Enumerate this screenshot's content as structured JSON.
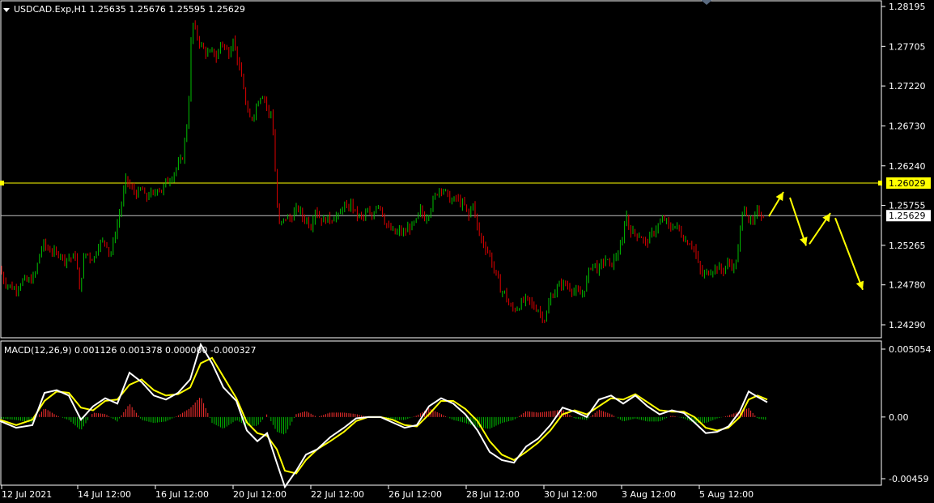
{
  "header": {
    "symbol_line": "USDCAD.Exp,H1  1.25635 1.25676 1.25595 1.25629"
  },
  "macd_header": "MACD(12,26,9) 0.001126 0.001378 0.000000 -0.000327",
  "colors": {
    "background": "#000000",
    "bull": "#00c000",
    "bear": "#e00000",
    "axis": "#ffffff",
    "level": "#ffff00",
    "price_line": "#c0c0c0",
    "macd_line": "#ffffff",
    "signal_line": "#ffff00",
    "hist_pos": "#ff3030",
    "hist_neg": "#00c000",
    "arrow": "#ffff00"
  },
  "chart_data": [
    {
      "type": "candlestick",
      "title": "USDCAD.Exp,H1",
      "current_quote": {
        "open": 1.25635,
        "high": 1.25676,
        "low": 1.25595,
        "close": 1.25629
      },
      "y_ticks": [
        "1.28195",
        "1.27705",
        "1.27220",
        "1.26730",
        "1.26240",
        "1.25755",
        "1.25265",
        "1.24780",
        "1.24290"
      ],
      "ylim": [
        1.241,
        1.283
      ],
      "x_ticks": [
        "12 Jul 2021",
        "14 Jul 12:00",
        "16 Jul 12:00",
        "20 Jul 12:00",
        "22 Jul 12:00",
        "26 Jul 12:00",
        "28 Jul 12:00",
        "30 Jul 12:00",
        "3 Aug 12:00",
        "5 Aug 12:00"
      ],
      "horizontal_level": {
        "value": 1.26029,
        "label": "1.26029"
      },
      "price_label": {
        "value": 1.25629,
        "label": "1.25629"
      },
      "close_path": [
        [
          0,
          1.2498
        ],
        [
          4,
          1.2485
        ],
        [
          9,
          1.2478
        ],
        [
          14,
          1.2476
        ],
        [
          19,
          1.2472
        ],
        [
          24,
          1.2479
        ],
        [
          29,
          1.2484
        ],
        [
          34,
          1.2482
        ],
        [
          39,
          1.2485
        ],
        [
          44,
          1.2492
        ],
        [
          49,
          1.2517
        ],
        [
          54,
          1.2528
        ],
        [
          59,
          1.2522
        ],
        [
          64,
          1.252
        ],
        [
          69,
          1.2515
        ],
        [
          74,
          1.2518
        ],
        [
          79,
          1.2508
        ],
        [
          84,
          1.2512
        ],
        [
          89,
          1.251
        ],
        [
          94,
          1.2516
        ],
        [
          98,
          1.2468
        ],
        [
          103,
          1.2508
        ],
        [
          107,
          1.2519
        ],
        [
          112,
          1.251
        ],
        [
          117,
          1.2512
        ],
        [
          121,
          1.2528
        ],
        [
          126,
          1.253
        ],
        [
          131,
          1.2532
        ],
        [
          136,
          1.2512
        ],
        [
          141,
          1.2535
        ],
        [
          146,
          1.2558
        ],
        [
          151,
          1.2582
        ],
        [
          156,
          1.261
        ],
        [
          160,
          1.2598
        ],
        [
          165,
          1.2594
        ],
        [
          170,
          1.2588
        ],
        [
          175,
          1.2598
        ],
        [
          180,
          1.2582
        ],
        [
          185,
          1.2592
        ],
        [
          190,
          1.2586
        ],
        [
          195,
          1.26
        ],
        [
          200,
          1.2592
        ],
        [
          205,
          1.2605
        ],
        [
          210,
          1.2608
        ],
        [
          215,
          1.2616
        ],
        [
          220,
          1.2625
        ],
        [
          225,
          1.2632
        ],
        [
          230,
          1.2665
        ],
        [
          234,
          1.2715
        ],
        [
          237,
          1.2805
        ],
        [
          240,
          1.2792
        ],
        [
          244,
          1.2782
        ],
        [
          248,
          1.2772
        ],
        [
          253,
          1.2765
        ],
        [
          258,
          1.276
        ],
        [
          263,
          1.2765
        ],
        [
          268,
          1.2755
        ],
        [
          273,
          1.2778
        ],
        [
          278,
          1.2768
        ],
        [
          283,
          1.2762
        ],
        [
          288,
          1.2782
        ],
        [
          292,
          1.2762
        ],
        [
          296,
          1.274
        ],
        [
          300,
          1.2728
        ],
        [
          305,
          1.2688
        ],
        [
          310,
          1.268
        ],
        [
          315,
          1.2692
        ],
        [
          320,
          1.2708
        ],
        [
          324,
          1.2712
        ],
        [
          328,
          1.2705
        ],
        [
          332,
          1.2685
        ],
        [
          336,
          1.2692
        ],
        [
          340,
          1.2618
        ],
        [
          344,
          1.255
        ],
        [
          349,
          1.2555
        ],
        [
          354,
          1.2562
        ],
        [
          359,
          1.2558
        ],
        [
          364,
          1.2568
        ],
        [
          369,
          1.2572
        ],
        [
          374,
          1.256
        ],
        [
          379,
          1.2558
        ],
        [
          384,
          1.2549
        ],
        [
          389,
          1.2572
        ],
        [
          394,
          1.2562
        ],
        [
          399,
          1.2556
        ],
        [
          404,
          1.256
        ],
        [
          409,
          1.2558
        ],
        [
          414,
          1.2564
        ],
        [
          419,
          1.256
        ],
        [
          424,
          1.2578
        ],
        [
          429,
          1.2568
        ],
        [
          434,
          1.258
        ],
        [
          439,
          1.2565
        ],
        [
          444,
          1.2562
        ],
        [
          449,
          1.256
        ],
        [
          454,
          1.2568
        ],
        [
          459,
          1.2558
        ],
        [
          464,
          1.2576
        ],
        [
          469,
          1.2578
        ],
        [
          474,
          1.256
        ],
        [
          479,
          1.2548
        ],
        [
          484,
          1.2545
        ],
        [
          489,
          1.254
        ],
        [
          494,
          1.2545
        ],
        [
          499,
          1.254
        ],
        [
          504,
          1.2548
        ],
        [
          509,
          1.255
        ],
        [
          514,
          1.2555
        ],
        [
          519,
          1.257
        ],
        [
          524,
          1.256
        ],
        [
          529,
          1.2565
        ],
        [
          534,
          1.2578
        ],
        [
          539,
          1.259
        ],
        [
          544,
          1.2598
        ],
        [
          549,
          1.2594
        ],
        [
          554,
          1.2585
        ],
        [
          559,
          1.258
        ],
        [
          564,
          1.2585
        ],
        [
          569,
          1.2578
        ],
        [
          574,
          1.2575
        ],
        [
          579,
          1.256
        ],
        [
          584,
          1.2582
        ],
        [
          589,
          1.255
        ],
        [
          594,
          1.2535
        ],
        [
          599,
          1.2525
        ],
        [
          604,
          1.2518
        ],
        [
          609,
          1.25
        ],
        [
          614,
          1.2488
        ],
        [
          619,
          1.247
        ],
        [
          624,
          1.2468
        ],
        [
          629,
          1.2452
        ],
        [
          634,
          1.2448
        ],
        [
          639,
          1.245
        ],
        [
          644,
          1.2455
        ],
        [
          649,
          1.246
        ],
        [
          654,
          1.2458
        ],
        [
          659,
          1.245
        ],
        [
          664,
          1.245
        ],
        [
          669,
          1.244
        ],
        [
          674,
          1.2435
        ],
        [
          679,
          1.246
        ],
        [
          684,
          1.2468
        ],
        [
          689,
          1.2475
        ],
        [
          694,
          1.248
        ],
        [
          699,
          1.2478
        ],
        [
          704,
          1.2475
        ],
        [
          709,
          1.247
        ],
        [
          714,
          1.2468
        ],
        [
          719,
          1.2465
        ],
        [
          724,
          1.248
        ],
        [
          729,
          1.25
        ],
        [
          734,
          1.2505
        ],
        [
          739,
          1.2495
        ],
        [
          744,
          1.2505
        ],
        [
          749,
          1.251
        ],
        [
          754,
          1.25
        ],
        [
          759,
          1.251
        ],
        [
          764,
          1.2518
        ],
        [
          769,
          1.253
        ],
        [
          773,
          1.257
        ],
        [
          777,
          1.2548
        ],
        [
          782,
          1.2542
        ],
        [
          787,
          1.254
        ],
        [
          792,
          1.2538
        ],
        [
          797,
          1.2528
        ],
        [
          802,
          1.2535
        ],
        [
          807,
          1.2542
        ],
        [
          812,
          1.255
        ],
        [
          817,
          1.2555
        ],
        [
          822,
          1.256
        ],
        [
          827,
          1.2545
        ],
        [
          832,
          1.2552
        ],
        [
          837,
          1.2548
        ],
        [
          842,
          1.254
        ],
        [
          847,
          1.2532
        ],
        [
          852,
          1.253
        ],
        [
          857,
          1.2525
        ],
        [
          862,
          1.2505
        ],
        [
          867,
          1.249
        ],
        [
          872,
          1.2492
        ],
        [
          877,
          1.2495
        ],
        [
          882,
          1.2498
        ],
        [
          887,
          1.25
        ],
        [
          892,
          1.2494
        ],
        [
          897,
          1.2502
        ],
        [
          902,
          1.2505
        ],
        [
          907,
          1.2498
        ],
        [
          912,
          1.252
        ],
        [
          916,
          1.256
        ],
        [
          920,
          1.2575
        ],
        [
          925,
          1.2558
        ],
        [
          930,
          1.2552
        ],
        [
          935,
          1.2568
        ],
        [
          940,
          1.2565
        ],
        [
          945,
          1.2563
        ]
      ]
    },
    {
      "type": "macd",
      "title": "MACD(12,26,9)",
      "values": {
        "macd": 0.001126,
        "signal": 0.001378,
        "third": 0.0,
        "fourth": -0.000327
      },
      "y_ticks": [
        "0.005054",
        "0.00",
        "-0.00459"
      ],
      "ylim": [
        -0.005,
        0.0054
      ],
      "macd_path": [
        [
          0,
          -0.0003
        ],
        [
          20,
          -0.0008
        ],
        [
          40,
          -0.0006
        ],
        [
          55,
          0.0018
        ],
        [
          70,
          0.002
        ],
        [
          85,
          0.0016
        ],
        [
          100,
          -0.0002
        ],
        [
          115,
          0.0008
        ],
        [
          130,
          0.0014
        ],
        [
          145,
          0.001
        ],
        [
          160,
          0.0033
        ],
        [
          175,
          0.0026
        ],
        [
          190,
          0.0016
        ],
        [
          205,
          0.0013
        ],
        [
          220,
          0.0018
        ],
        [
          235,
          0.0028
        ],
        [
          248,
          0.0054
        ],
        [
          262,
          0.004
        ],
        [
          276,
          0.0022
        ],
        [
          292,
          0.0012
        ],
        [
          305,
          -0.001
        ],
        [
          318,
          -0.0018
        ],
        [
          330,
          -0.0012
        ],
        [
          342,
          -0.0034
        ],
        [
          352,
          -0.0052
        ],
        [
          366,
          -0.004
        ],
        [
          378,
          -0.0028
        ],
        [
          392,
          -0.0024
        ],
        [
          408,
          -0.0015
        ],
        [
          425,
          -0.0008
        ],
        [
          440,
          -0.0001
        ],
        [
          455,
          0.0
        ],
        [
          470,
          0.0
        ],
        [
          485,
          -0.0004
        ],
        [
          500,
          -0.0008
        ],
        [
          515,
          -0.0006
        ],
        [
          530,
          0.0008
        ],
        [
          545,
          0.0014
        ],
        [
          560,
          0.001
        ],
        [
          575,
          0.0002
        ],
        [
          590,
          -0.001
        ],
        [
          605,
          -0.0026
        ],
        [
          620,
          -0.0032
        ],
        [
          635,
          -0.0034
        ],
        [
          650,
          -0.0022
        ],
        [
          665,
          -0.0016
        ],
        [
          680,
          -0.0006
        ],
        [
          695,
          0.0007
        ],
        [
          710,
          0.0004
        ],
        [
          725,
          0.0
        ],
        [
          740,
          0.0013
        ],
        [
          755,
          0.0016
        ],
        [
          770,
          0.001
        ],
        [
          785,
          0.0016
        ],
        [
          800,
          0.0008
        ],
        [
          815,
          0.0002
        ],
        [
          830,
          0.0005
        ],
        [
          845,
          0.0003
        ],
        [
          858,
          -0.0004
        ],
        [
          872,
          -0.0012
        ],
        [
          886,
          -0.0011
        ],
        [
          900,
          -0.0007
        ],
        [
          914,
          0.0004
        ],
        [
          925,
          0.0019
        ],
        [
          936,
          0.0015
        ],
        [
          948,
          0.0011
        ]
      ],
      "signal_path": [
        [
          0,
          -0.0002
        ],
        [
          20,
          -0.0006
        ],
        [
          40,
          -0.0002
        ],
        [
          55,
          0.0012
        ],
        [
          70,
          0.0019
        ],
        [
          85,
          0.0018
        ],
        [
          100,
          0.0007
        ],
        [
          115,
          0.0005
        ],
        [
          130,
          0.0012
        ],
        [
          145,
          0.0013
        ],
        [
          160,
          0.0024
        ],
        [
          175,
          0.0028
        ],
        [
          190,
          0.002
        ],
        [
          205,
          0.0016
        ],
        [
          220,
          0.0017
        ],
        [
          235,
          0.0022
        ],
        [
          248,
          0.004
        ],
        [
          262,
          0.0044
        ],
        [
          276,
          0.003
        ],
        [
          292,
          0.0014
        ],
        [
          305,
          -0.0004
        ],
        [
          318,
          -0.0012
        ],
        [
          330,
          -0.0014
        ],
        [
          342,
          -0.0024
        ],
        [
          352,
          -0.004
        ],
        [
          366,
          -0.0042
        ],
        [
          378,
          -0.0032
        ],
        [
          392,
          -0.0024
        ],
        [
          408,
          -0.0018
        ],
        [
          425,
          -0.0011
        ],
        [
          440,
          -0.0003
        ],
        [
          455,
          0.0
        ],
        [
          470,
          0.0
        ],
        [
          485,
          -0.0002
        ],
        [
          500,
          -0.0006
        ],
        [
          515,
          -0.0007
        ],
        [
          530,
          0.0002
        ],
        [
          545,
          0.0012
        ],
        [
          560,
          0.0012
        ],
        [
          575,
          0.0006
        ],
        [
          590,
          -0.0003
        ],
        [
          605,
          -0.0018
        ],
        [
          620,
          -0.0028
        ],
        [
          635,
          -0.0032
        ],
        [
          650,
          -0.0026
        ],
        [
          665,
          -0.0019
        ],
        [
          680,
          -0.001
        ],
        [
          695,
          0.0002
        ],
        [
          710,
          0.0005
        ],
        [
          725,
          0.0002
        ],
        [
          740,
          0.0008
        ],
        [
          755,
          0.0014
        ],
        [
          770,
          0.0013
        ],
        [
          785,
          0.0017
        ],
        [
          800,
          0.0011
        ],
        [
          815,
          0.0005
        ],
        [
          830,
          0.0004
        ],
        [
          845,
          0.0004
        ],
        [
          858,
          0.0
        ],
        [
          872,
          -0.0008
        ],
        [
          886,
          -0.001
        ],
        [
          900,
          -0.0008
        ],
        [
          914,
          0.0
        ],
        [
          925,
          0.0013
        ],
        [
          936,
          0.0016
        ],
        [
          948,
          0.0013
        ]
      ]
    }
  ],
  "forecast_arrows": [
    {
      "from": [
        950,
        1.2562
      ],
      "to": [
        968,
        1.2592
      ]
    },
    {
      "from": [
        976,
        1.2585
      ],
      "to": [
        996,
        1.2526
      ]
    },
    {
      "from": [
        1000,
        1.2528
      ],
      "to": [
        1026,
        1.2566
      ]
    },
    {
      "from": [
        1032,
        1.256
      ],
      "to": [
        1066,
        1.2472
      ]
    }
  ]
}
